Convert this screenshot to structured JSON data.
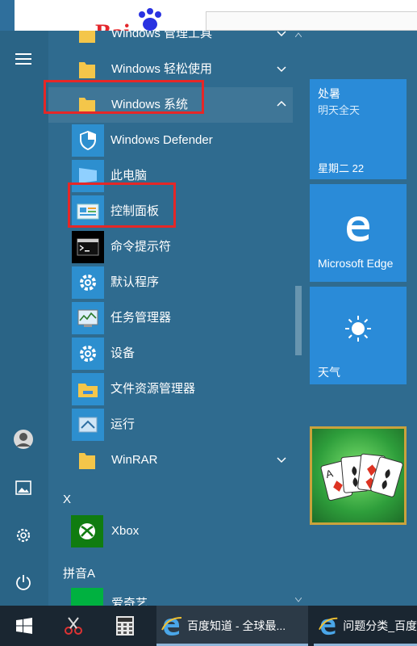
{
  "background": {
    "logo_text": "Bai"
  },
  "rail": {
    "icons": [
      "hamburger-icon",
      "user-avatar",
      "pictures-icon",
      "settings-icon",
      "power-icon"
    ]
  },
  "apps": [
    {
      "label": "Windows 管理工具",
      "icon": "folder-icon",
      "expandable": true,
      "expanded": false
    },
    {
      "label": "Windows 轻松使用",
      "icon": "folder-icon",
      "expandable": true,
      "expanded": false
    },
    {
      "label": "Windows 系统",
      "icon": "folder-icon",
      "expandable": true,
      "expanded": true
    },
    {
      "label": "Windows Defender",
      "icon": "shield-icon",
      "sub": true
    },
    {
      "label": "此电脑",
      "icon": "computer-icon",
      "sub": true
    },
    {
      "label": "控制面板",
      "icon": "control-panel-icon",
      "sub": true
    },
    {
      "label": "命令提示符",
      "icon": "cmd-icon",
      "sub": true
    },
    {
      "label": "默认程序",
      "icon": "gear-icon",
      "sub": true
    },
    {
      "label": "任务管理器",
      "icon": "task-manager-icon",
      "sub": true
    },
    {
      "label": "设备",
      "icon": "gear-icon",
      "sub": true
    },
    {
      "label": "文件资源管理器",
      "icon": "file-explorer-icon",
      "sub": true
    },
    {
      "label": "运行",
      "icon": "run-icon",
      "sub": true
    },
    {
      "label": "WinRAR",
      "icon": "folder-icon",
      "expandable": true,
      "expanded": false
    }
  ],
  "section_x": "X",
  "xbox": "Xbox",
  "section_pinyin": "拼音A",
  "iqiyi": "爱奇艺",
  "tiles": {
    "weather_small": {
      "line1": "处暑",
      "line2": "明天全天",
      "line3": "星期二 22"
    },
    "edge": {
      "label": "Microsoft Edge"
    },
    "weather": {
      "label": "天气"
    },
    "solitaire": {
      "label": ""
    }
  },
  "taskbar": {
    "start": "windows-start-icon",
    "items": [
      {
        "icon": "snipping-tool-icon",
        "label": ""
      },
      {
        "icon": "calculator-icon",
        "label": ""
      },
      {
        "icon": "ie-icon",
        "label": "百度知道 - 全球最..."
      },
      {
        "icon": "ie-icon",
        "label": "问题分类_百度"
      }
    ]
  },
  "colors": {
    "accent": "#2a8bd8",
    "highlight": "#e52727",
    "menu_bg": "#2f6b8f"
  }
}
